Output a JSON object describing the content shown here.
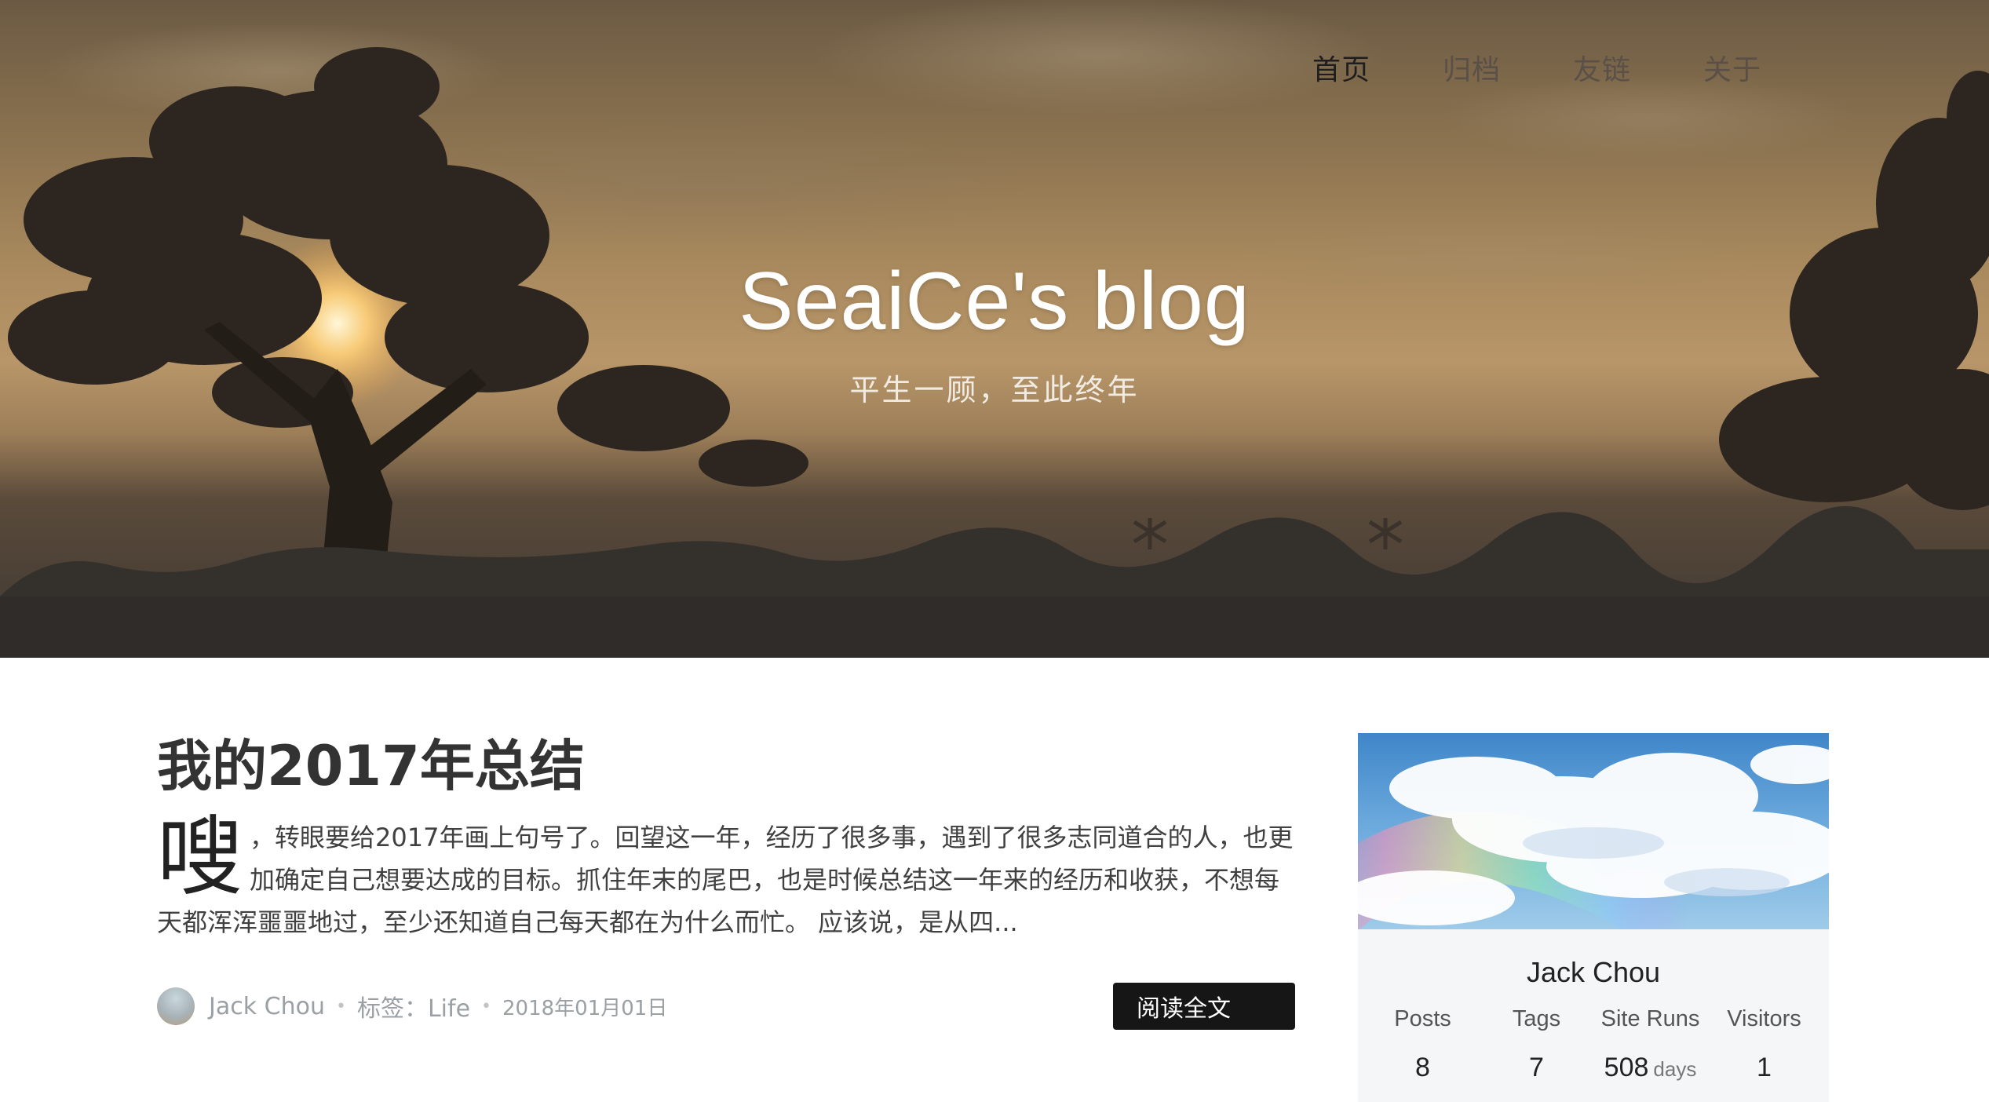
{
  "nav": {
    "items": [
      {
        "label": "首页",
        "active": true
      },
      {
        "label": "归档",
        "active": false
      },
      {
        "label": "友链",
        "active": false
      },
      {
        "label": "关于",
        "active": false
      }
    ]
  },
  "hero": {
    "title": "SeaiCe's blog",
    "subtitle": "平生一顾，至此终年"
  },
  "post": {
    "title": "我的2017年总结",
    "dropcap": "嗖",
    "excerpt": "嗖，转眼要给2017年画上句号了。回望这一年，经历了很多事，遇到了很多志同道合的人，也更加确定自己想要达成的目标。抓住年末的尾巴，也是时候总结这一年来的经历和收获，不想每天都浑浑噩噩地过，至少还知道自己每天都在为什么而忙。 应该说，是从四...",
    "author": "Jack Chou",
    "tags": "标签：Life",
    "date": "2018年01月01日",
    "read_more": "阅读全文"
  },
  "profile": {
    "name": "Jack Chou",
    "stats": {
      "posts_label": "Posts",
      "posts_value": "8",
      "tags_label": "Tags",
      "tags_value": "7",
      "runs_label": "Site Runs",
      "runs_value": "508",
      "runs_unit": "days",
      "visitors_label": "Visitors",
      "visitors_value": "1"
    }
  },
  "colors": {
    "read_more_bg": "#161616",
    "card_bg": "#f4f6f8"
  }
}
